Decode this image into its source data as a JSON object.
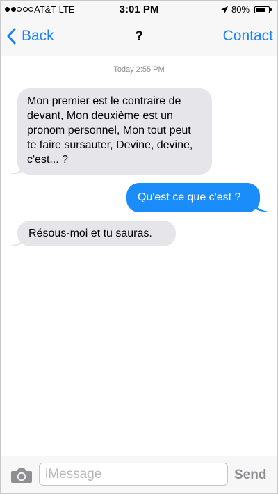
{
  "status_bar": {
    "signal_bars": 5,
    "signal_filled": 2,
    "carrier": "AT&T LTE",
    "time": "3:01 PM",
    "battery_percent_label": "80%",
    "battery_level": 0.8
  },
  "nav": {
    "back_label": "Back",
    "title": "?",
    "contact_label": "Contact"
  },
  "conversation": {
    "timestamp": "Today 2:55 PM",
    "messages": [
      {
        "direction": "incoming",
        "text": "Mon premier est le contraire de devant, Mon deuxième est un pronom personnel, Mon tout peut te faire sursauter, Devine, devine, c'est... ?"
      },
      {
        "direction": "outgoing",
        "text": "Qu'est ce que c'est ?"
      },
      {
        "direction": "incoming",
        "text": "Résous-moi et tu sauras."
      }
    ]
  },
  "composer": {
    "placeholder": "iMessage",
    "value": "",
    "send_label": "Send"
  },
  "colors": {
    "accent": "#1a82fb",
    "outgoing_bubble": "#1a8dfb",
    "incoming_bubble": "#e5e5ea",
    "send_disabled": "#8e8e93"
  },
  "icons": {
    "back": "chevron-left-icon",
    "location": "location-arrow-icon",
    "camera": "camera-icon",
    "battery": "battery-icon"
  }
}
